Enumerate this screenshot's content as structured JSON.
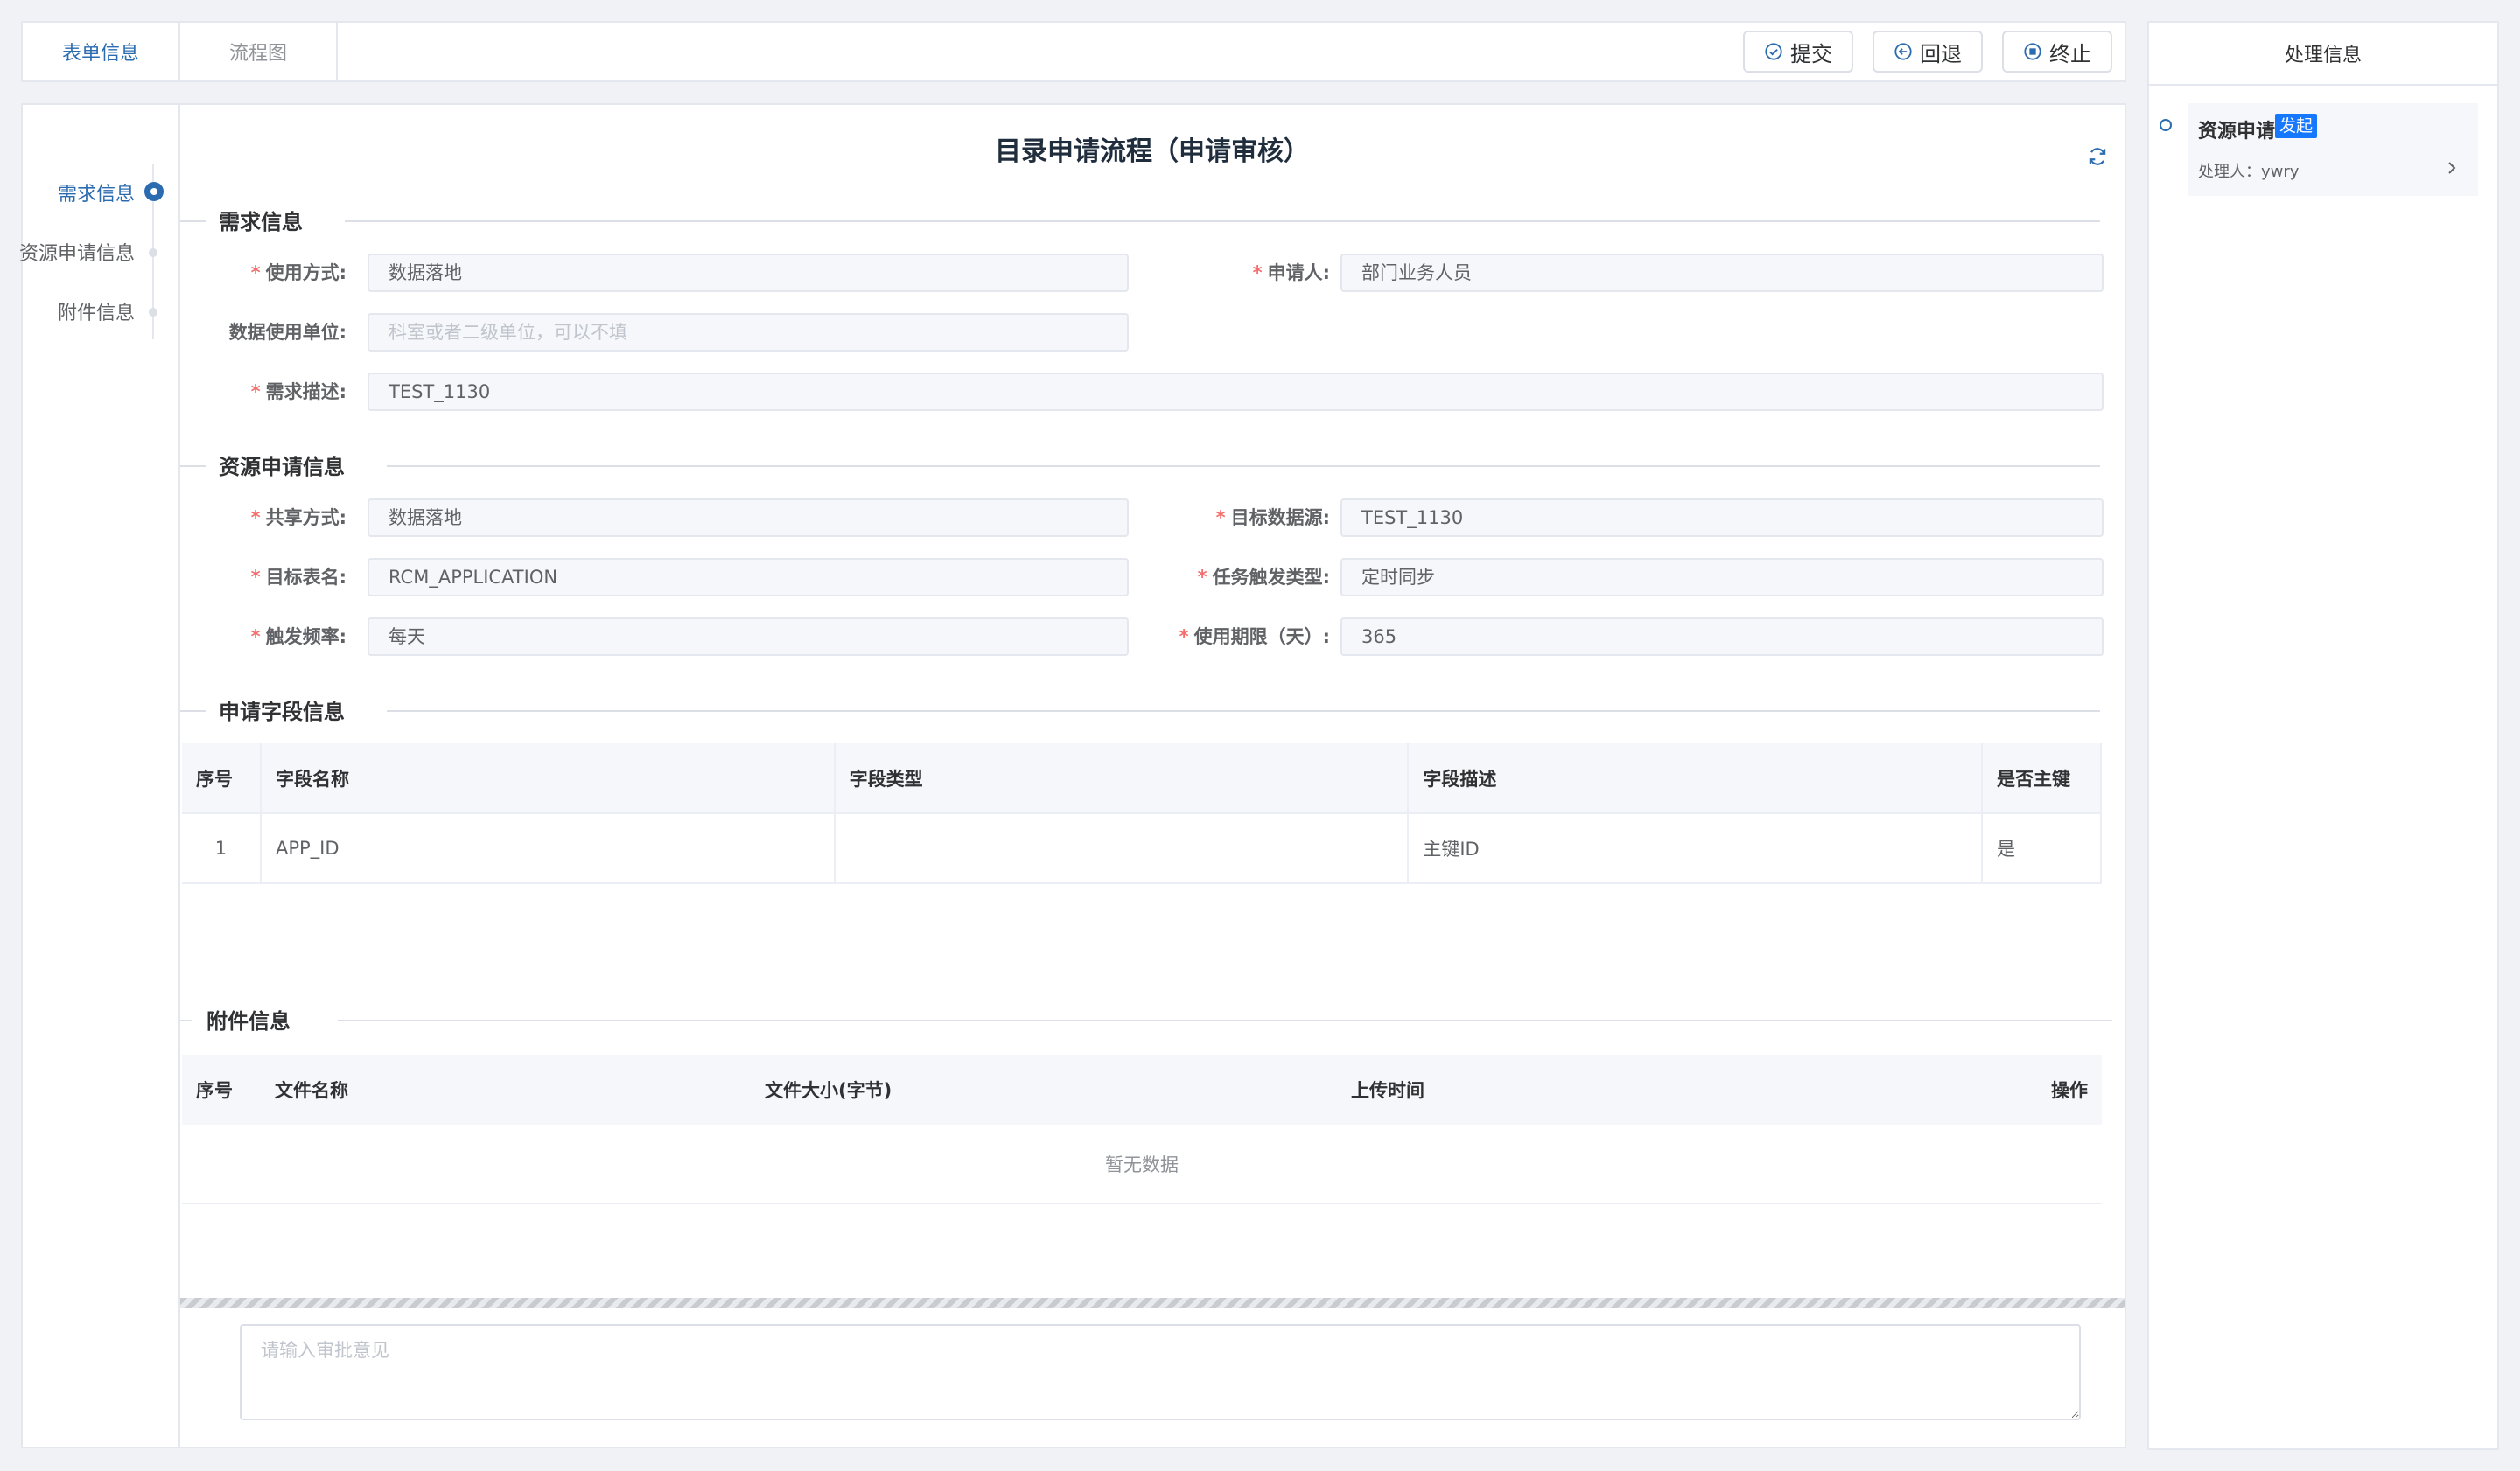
{
  "tabs": [
    {
      "label": "表单信息",
      "active": true
    },
    {
      "label": "流程图",
      "active": false
    }
  ],
  "actions": {
    "submit": "提交",
    "back": "回退",
    "terminate": "终止"
  },
  "side_nav": [
    {
      "label": "需求信息",
      "active": true
    },
    {
      "label": "资源申请信息",
      "active": false
    },
    {
      "label": "附件信息",
      "active": false
    }
  ],
  "form": {
    "title": "目录申请流程（申请审核）",
    "sections": {
      "demand": "需求信息",
      "resource": "资源申请信息",
      "fields": "申请字段信息",
      "attachments": "附件信息"
    },
    "demand": {
      "usage_mode": {
        "label": "使用方式:",
        "value": "数据落地"
      },
      "applicant": {
        "label": "申请人:",
        "value": "部门业务人员"
      },
      "data_unit": {
        "label": "数据使用单位:",
        "placeholder": "科室或者二级单位，可以不填"
      },
      "description": {
        "label": "需求描述:",
        "value": "TEST_1130"
      }
    },
    "resource": {
      "share_mode": {
        "label": "共享方式:",
        "value": "数据落地"
      },
      "target_source": {
        "label": "目标数据源:",
        "value": "TEST_1130"
      },
      "target_table": {
        "label": "目标表名:",
        "value": "RCM_APPLICATION"
      },
      "trigger_type": {
        "label": "任务触发类型:",
        "value": "定时同步"
      },
      "frequency": {
        "label": "触发频率:",
        "value": "每天"
      },
      "period": {
        "label": "使用期限（天）:",
        "value": "365"
      }
    },
    "fields_table": {
      "headers": [
        "序号",
        "字段名称",
        "字段类型",
        "字段描述",
        "是否主键"
      ],
      "rows": [
        [
          "1",
          "APP_ID",
          "",
          "主键ID",
          "是"
        ]
      ]
    },
    "attachments_table": {
      "headers": [
        "序号",
        "文件名称",
        "文件大小(字节)",
        "上传时间",
        "操作"
      ],
      "empty_text": "暂无数据"
    },
    "opinion_placeholder": "请输入审批意见"
  },
  "process_panel": {
    "title": "处理信息",
    "step_title": "资源申请",
    "step_badge": "发起",
    "handler": "处理人：ywry"
  },
  "colors": {
    "accent": "#2b6cb0",
    "badge": "#1677ff",
    "required": "#f56c6c"
  }
}
